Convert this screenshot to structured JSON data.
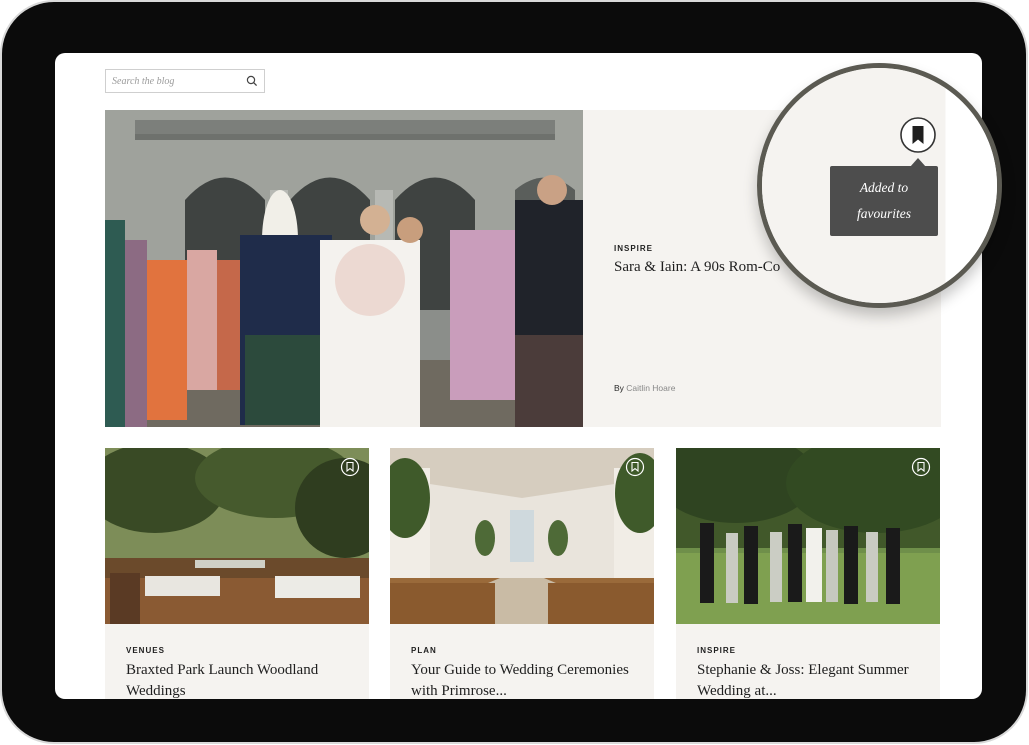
{
  "search": {
    "placeholder": "Search the blog"
  },
  "featured": {
    "category": "INSPIRE",
    "title": "Sara & Iain: A 90s Rom-Co",
    "byline_prefix": "By",
    "author": "Caitlin Hoare"
  },
  "favourite": {
    "tooltip_line1": "Added to",
    "tooltip_line2": "favourites"
  },
  "cards": [
    {
      "category": "VENUES",
      "title": "Braxted Park Launch Woodland Weddings"
    },
    {
      "category": "PLAN",
      "title": "Your Guide to Wedding Ceremonies with Primrose..."
    },
    {
      "category": "INSPIRE",
      "title": "Stephanie & Joss: Elegant Summer Wedding at..."
    }
  ],
  "colors": {
    "card_bg": "#f5f3f0",
    "tooltip_bg": "#4d4d4d",
    "magnifier_ring": "#5b5a52"
  }
}
